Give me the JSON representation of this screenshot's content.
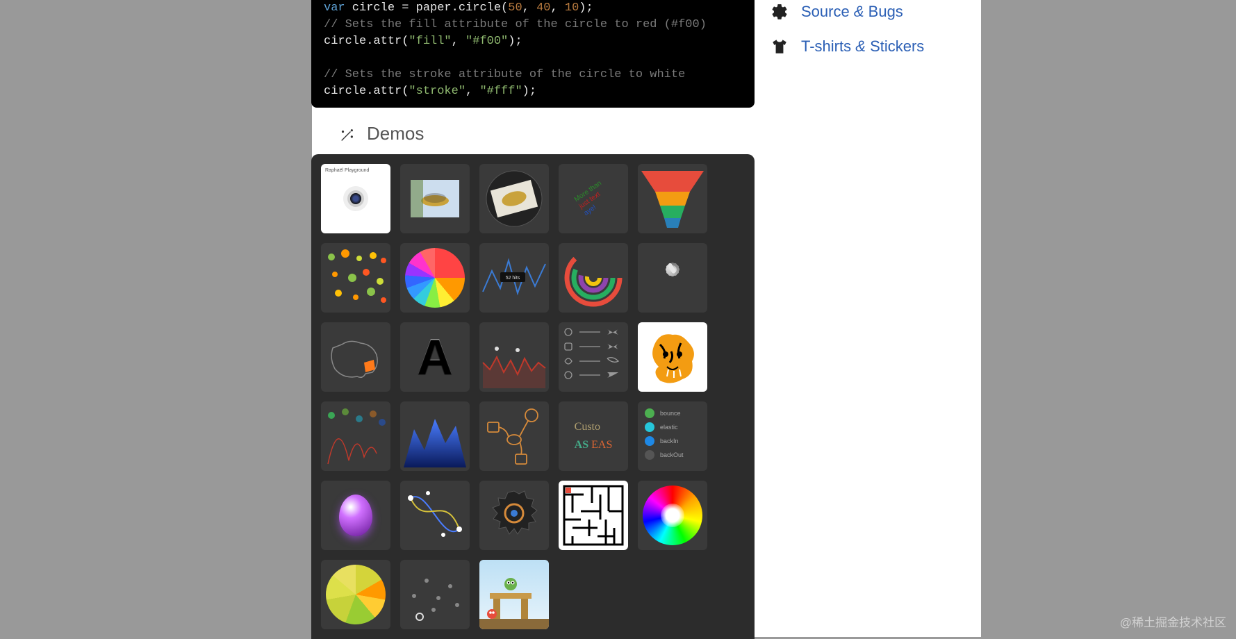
{
  "code": {
    "line1_pre": "var",
    "line1_mid": " circle = paper.circle(",
    "line1_args": [
      "50",
      "40",
      "10"
    ],
    "line1_end": ");",
    "line2_comment": "// Sets the fill attribute of the circle to red (#f00)",
    "line3_pre": "circle.attr(",
    "line3_str1": "\"fill\"",
    "line3_sep": ", ",
    "line3_str2": "\"#f00\"",
    "line3_end": ");",
    "line4_comment": "// Sets the stroke attribute of the circle to white",
    "line5_pre": "circle.attr(",
    "line5_str1": "\"stroke\"",
    "line5_sep": ", ",
    "line5_str2": "\"#fff\"",
    "line5_end": ");"
  },
  "demos": {
    "heading": "Demos",
    "tiles": [
      {
        "name": "playground",
        "caption": "Raphaël Playground"
      },
      {
        "name": "image-crop"
      },
      {
        "name": "image-rotation"
      },
      {
        "name": "text-rotation",
        "lines": [
          "More than",
          "just text",
          "aye!"
        ]
      },
      {
        "name": "funnel-chart"
      },
      {
        "name": "dots-scatter"
      },
      {
        "name": "pie-chart"
      },
      {
        "name": "analytics-chart",
        "tooltip": "52 hits"
      },
      {
        "name": "polar-clock"
      },
      {
        "name": "spinner"
      },
      {
        "name": "australia-map"
      },
      {
        "name": "custom-fonts-a",
        "letter": "A"
      },
      {
        "name": "area-chart-red"
      },
      {
        "name": "easing-diagram"
      },
      {
        "name": "tiger"
      },
      {
        "name": "bouncing-ball"
      },
      {
        "name": "area-chart-blue"
      },
      {
        "name": "graffle"
      },
      {
        "name": "custom-easing",
        "line1": "Custo",
        "line2_a": "AS ",
        "line2_b": "EAS"
      },
      {
        "name": "easing-list",
        "items": [
          {
            "label": "bounce",
            "color": "#4caf50"
          },
          {
            "label": "elastic",
            "color": "#26c6da"
          },
          {
            "label": "backIn",
            "color": "#1e88e5"
          },
          {
            "label": "backOut",
            "color": "#555"
          }
        ]
      },
      {
        "name": "3d-shiny"
      },
      {
        "name": "curver"
      },
      {
        "name": "gear"
      },
      {
        "name": "maze"
      },
      {
        "name": "color-picker"
      },
      {
        "name": "growing-pie"
      },
      {
        "name": "dots-animation"
      },
      {
        "name": "angry-birds"
      }
    ]
  },
  "links": [
    {
      "label_a": "Source",
      "amp": "&",
      "label_b": "Bugs",
      "icon": "gear"
    },
    {
      "label_a": "T-shirts",
      "amp": "&",
      "label_b": "Stickers",
      "icon": "tshirt"
    }
  ],
  "watermark": "@稀土掘金技术社区"
}
